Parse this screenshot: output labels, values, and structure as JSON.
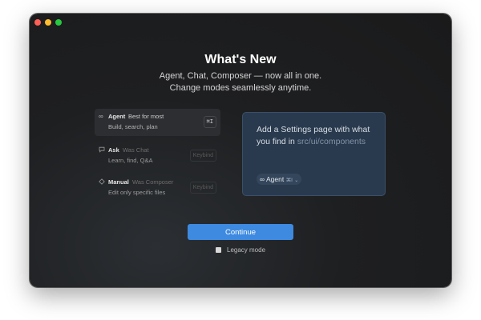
{
  "window": {
    "controls": [
      "close",
      "minimize",
      "zoom"
    ]
  },
  "header": {
    "title": "What's New",
    "subtitle_line1": "Agent, Chat, Composer — now all in one.",
    "subtitle_line2": "Change modes seamlessly anytime."
  },
  "modes": [
    {
      "icon": "infinity-icon",
      "name": "Agent",
      "note": "Best for most",
      "desc": "Build, search, plan",
      "shortcut": "⌘I",
      "active": true
    },
    {
      "icon": "chat-bubble-icon",
      "name": "Ask",
      "note": "Was Chat",
      "desc": "Learn, find, Q&A",
      "shortcut": "Keybind",
      "active": false
    },
    {
      "icon": "diamond-icon",
      "name": "Manual",
      "note": "Was Composer",
      "desc": "Edit only specific files",
      "shortcut": "Keybind",
      "active": false
    }
  ],
  "preview": {
    "prompt_text": "Add a Settings page with what you find in",
    "prompt_path": "src/ui/components",
    "chip_icon": "∞",
    "chip_label": "Agent",
    "chip_shortcut": "⌘I",
    "chip_chevron": "⌄"
  },
  "actions": {
    "continue_label": "Continue"
  },
  "legacy": {
    "label": "Legacy mode",
    "checked": false
  },
  "colors": {
    "accent": "#3d8ae0",
    "preview_bg": "#2a3a4e",
    "window_bg": "#1e1f21"
  }
}
